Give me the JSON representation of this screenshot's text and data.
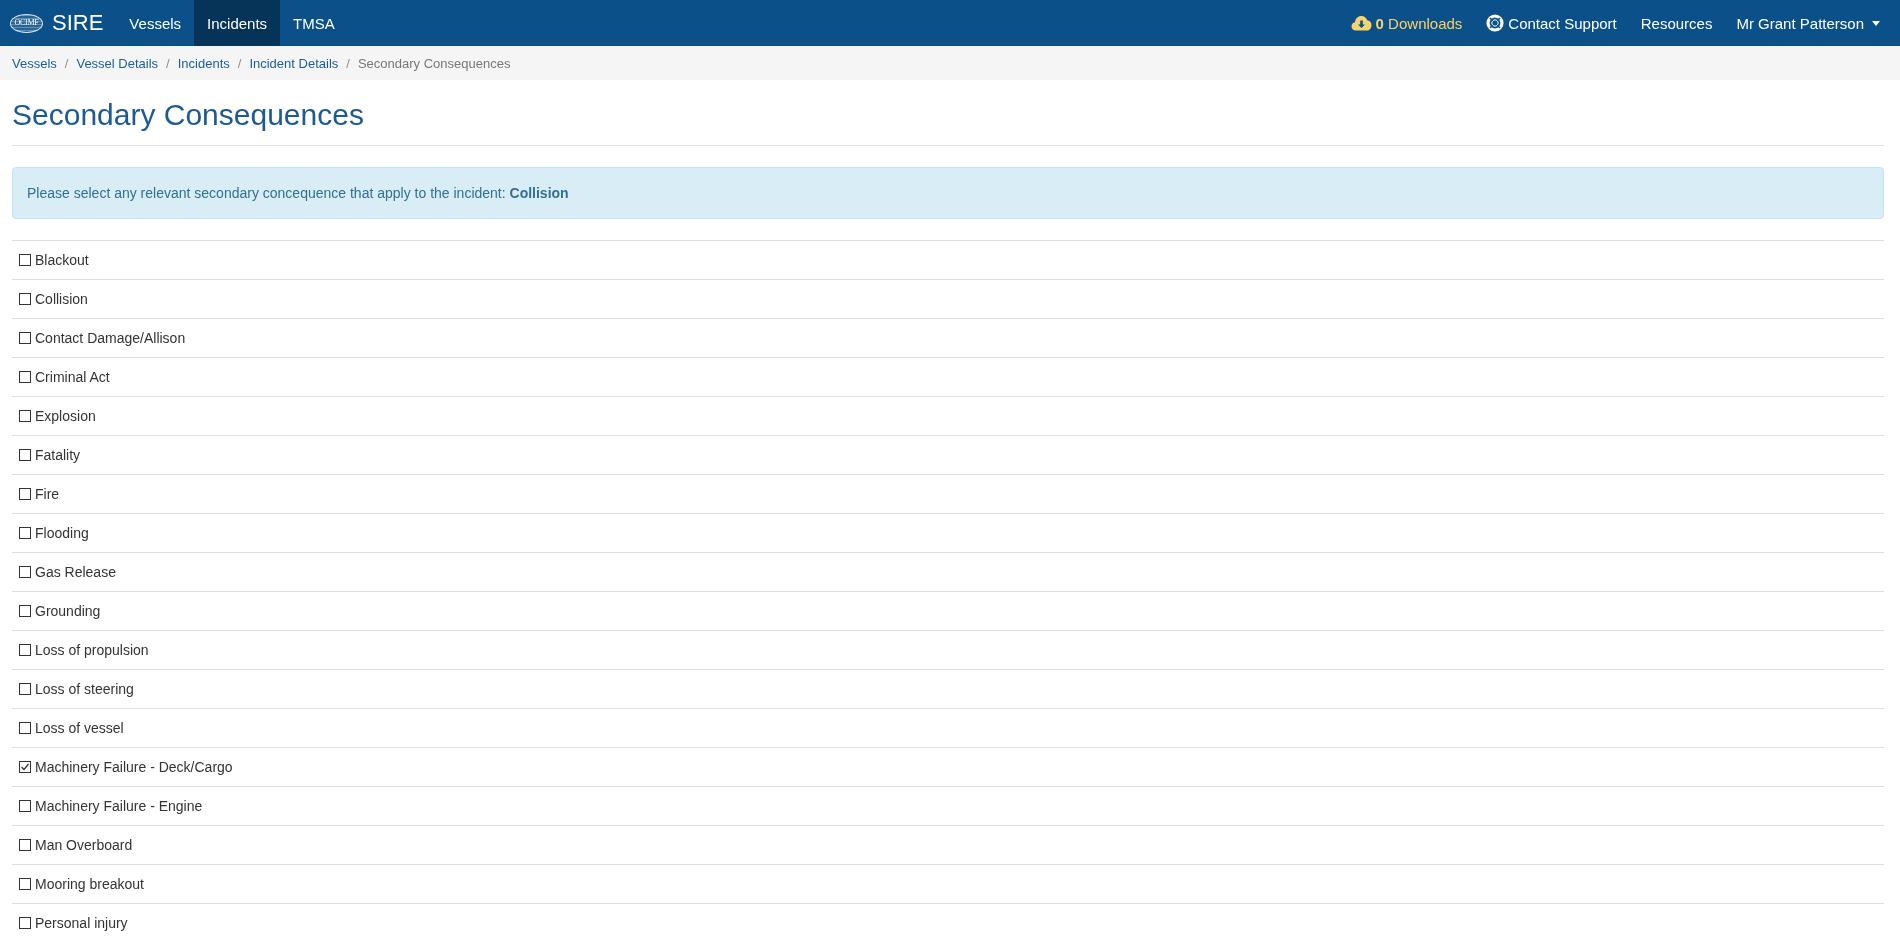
{
  "navbar": {
    "logo_text": "OCIMF",
    "brand": "SIRE",
    "nav_items": [
      {
        "label": "Vessels",
        "selected": false
      },
      {
        "label": "Incidents",
        "selected": true
      },
      {
        "label": "TMSA",
        "selected": false
      }
    ],
    "downloads": "**0** Downloads",
    "contact_support": "Contact Support",
    "resources": "Resources",
    "user_name": "Mr Grant Patterson"
  },
  "breadcrumbs": [
    {
      "label": "Vessels",
      "active": false
    },
    {
      "separator": "/",
      "label": "Vessel Details",
      "active": false
    },
    {
      "separator": "/",
      "label": "Incidents",
      "active": false
    },
    {
      "separator": "/",
      "label": "Incident Details",
      "active": false
    },
    {
      "separator": "/",
      "label": "Secondary Consequences",
      "active": true
    }
  ],
  "page_title": "Secondary Consequences",
  "alert": "Please select any relevant secondary concequence that apply to the incident: **Collision**",
  "consequences": [
    {
      "label": "Blackout",
      "checked": false
    },
    {
      "label": "Collision",
      "checked": false
    },
    {
      "label": "Contact Damage/Allison",
      "checked": false
    },
    {
      "label": "Criminal Act",
      "checked": false
    },
    {
      "label": "Explosion",
      "checked": false
    },
    {
      "label": "Fatality",
      "checked": false
    },
    {
      "label": "Fire",
      "checked": false
    },
    {
      "label": "Flooding",
      "checked": false
    },
    {
      "label": "Gas Release",
      "checked": false
    },
    {
      "label": "Grounding",
      "checked": false
    },
    {
      "label": "Loss of propulsion",
      "checked": false
    },
    {
      "label": "Loss of steering",
      "checked": false
    },
    {
      "label": "Loss of vessel",
      "checked": false
    },
    {
      "label": "Machinery Failure - Deck/Cargo",
      "checked": true
    },
    {
      "label": "Machinery Failure - Engine",
      "checked": false
    },
    {
      "label": "Man Overboard",
      "checked": false
    },
    {
      "label": "Mooring breakout",
      "checked": false
    },
    {
      "label": "Personal injury",
      "checked": false
    }
  ]
}
